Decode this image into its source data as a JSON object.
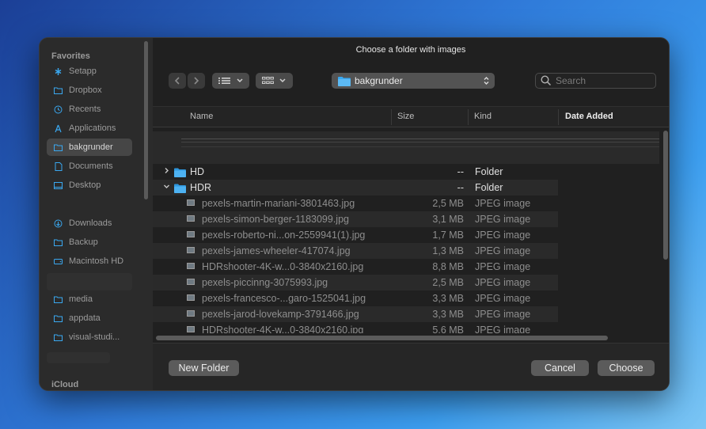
{
  "dialog": {
    "title": "Choose a folder with images"
  },
  "sidebar": {
    "favorites_heading": "Favorites",
    "icloud_heading": "iCloud",
    "items": [
      {
        "label": "Setapp",
        "icon": "setapp-icon",
        "selected": false
      },
      {
        "label": "Dropbox",
        "icon": "folder-icon",
        "selected": false
      },
      {
        "label": "Recents",
        "icon": "clock-icon",
        "selected": false
      },
      {
        "label": "Applications",
        "icon": "applications-icon",
        "selected": false
      },
      {
        "label": "bakgrunder",
        "icon": "folder-icon",
        "selected": true
      },
      {
        "label": "Documents",
        "icon": "document-icon",
        "selected": false
      },
      {
        "label": "Desktop",
        "icon": "desktop-icon",
        "selected": false
      },
      {
        "label": "Downloads",
        "icon": "download-icon",
        "selected": false
      },
      {
        "label": "Backup",
        "icon": "folder-icon",
        "selected": false
      },
      {
        "label": "Macintosh HD",
        "icon": "drive-icon",
        "selected": false
      },
      {
        "label": "media",
        "icon": "folder-icon",
        "selected": false
      },
      {
        "label": "appdata",
        "icon": "folder-icon",
        "selected": false
      },
      {
        "label": "visual-studi...",
        "icon": "folder-icon",
        "selected": false
      }
    ]
  },
  "toolbar": {
    "back_icon": "chevron-left-icon",
    "forward_icon": "chevron-right-icon",
    "list_view_icon": "list-view-icon",
    "grid_view_icon": "grid-view-icon",
    "location": "bakgrunder",
    "search_placeholder": "Search"
  },
  "columns": {
    "name": "Name",
    "size": "Size",
    "kind": "Kind",
    "date_added": "Date Added"
  },
  "rows": [
    {
      "name": "HD",
      "size": "--",
      "kind": "Folder",
      "type": "folder",
      "expanded": false
    },
    {
      "name": "HDR",
      "size": "--",
      "kind": "Folder",
      "type": "folder",
      "expanded": true
    },
    {
      "name": "pexels-martin-mariani-3801463.jpg",
      "size": "2,5 MB",
      "kind": "JPEG image",
      "type": "file"
    },
    {
      "name": "pexels-simon-berger-1183099.jpg",
      "size": "3,1 MB",
      "kind": "JPEG image",
      "type": "file"
    },
    {
      "name": "pexels-roberto-ni...on-2559941(1).jpg",
      "size": "1,7 MB",
      "kind": "JPEG image",
      "type": "file"
    },
    {
      "name": "pexels-james-wheeler-417074.jpg",
      "size": "1,3 MB",
      "kind": "JPEG image",
      "type": "file"
    },
    {
      "name": "HDRshooter-4K-w...0-3840x2160.jpg",
      "size": "8,8 MB",
      "kind": "JPEG image",
      "type": "file"
    },
    {
      "name": "pexels-piccinng-3075993.jpg",
      "size": "2,5 MB",
      "kind": "JPEG image",
      "type": "file"
    },
    {
      "name": "pexels-francesco-...garo-1525041.jpg",
      "size": "3,3 MB",
      "kind": "JPEG image",
      "type": "file"
    },
    {
      "name": "pexels-jarod-lovekamp-3791466.jpg",
      "size": "3,3 MB",
      "kind": "JPEG image",
      "type": "file"
    },
    {
      "name": "HDRshooter-4K-w...0-3840x2160.jpg",
      "size": "5,6 MB",
      "kind": "JPEG image",
      "type": "file"
    }
  ],
  "buttons": {
    "new_folder": "New Folder",
    "cancel": "Cancel",
    "choose": "Choose"
  },
  "colors": {
    "folder_blue": "#3aa8f0",
    "dialog_bg": "#262626",
    "selection_gray": "#464646"
  }
}
